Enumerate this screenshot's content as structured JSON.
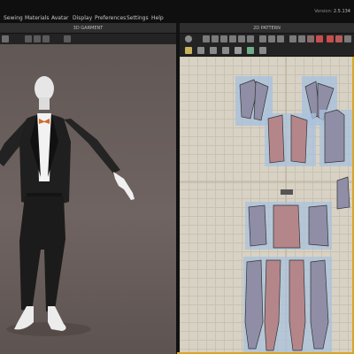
{
  "menu": {
    "items": [
      "Sewing",
      "Materials",
      "Avatar",
      "Display",
      "Preferences",
      "Settings",
      "Help"
    ],
    "version_label": "Version:",
    "version_value": "2.5.134"
  },
  "panels": {
    "left_title": "3D GARMENT",
    "right_title": "2D PATTERN"
  },
  "colors": {
    "accent_border": "#d9a52a",
    "pattern_piece_fill": "#b4868a",
    "pattern_highlight": "#a9c2dd",
    "viewport_bg": "#6a5f5c"
  },
  "icons": {
    "left_toolbar": [
      "select-icon",
      "camera-icon",
      "rotate-icon",
      "scale-icon",
      "view-icon"
    ],
    "right_toolbar_row1": [
      "refresh-icon",
      "select-icon",
      "move-icon",
      "transform-icon",
      "edit-point-icon",
      "add-point-icon",
      "curve-icon",
      "rectangle-icon",
      "ellipse-icon",
      "polygon-icon",
      "internal-line-icon",
      "dart-icon",
      "fold-icon",
      "fabric-icon",
      "texture-icon",
      "pin-icon",
      "unpin-icon",
      "settings-icon"
    ],
    "right_toolbar_row2": [
      "seam-icon",
      "stitch-icon",
      "free-sewing-icon",
      "segment-icon",
      "measure-icon",
      "tape-icon",
      "check-icon"
    ]
  }
}
